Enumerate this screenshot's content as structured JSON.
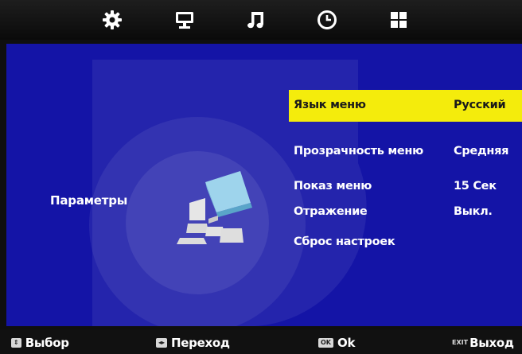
{
  "tabs": [
    {
      "icon": "gear-icon",
      "active": true
    },
    {
      "icon": "monitor-icon",
      "active": false
    },
    {
      "icon": "music-note-icon",
      "active": false
    },
    {
      "icon": "clock-icon",
      "active": false
    },
    {
      "icon": "grid-icon",
      "active": false
    }
  ],
  "section_title": "Параметры",
  "menu": [
    {
      "label": "Язык меню",
      "value": "Русский",
      "selected": true
    },
    {
      "label": "Прозрачность меню",
      "value": "Средняя",
      "selected": false
    },
    {
      "label": "Показ меню",
      "value": "15 Сек",
      "selected": false
    },
    {
      "label": "Отражение",
      "value": "Выкл.",
      "selected": false
    },
    {
      "label": "Сброс настроек",
      "value": "",
      "selected": false
    }
  ],
  "hints": [
    {
      "key": "⇕",
      "label": "Выбор"
    },
    {
      "key": "◂▸",
      "label": "Переход"
    },
    {
      "key": "OK",
      "label": "Ok"
    },
    {
      "key": "EXIT",
      "label": "Выход"
    }
  ],
  "colors": {
    "panel": "#1414a6",
    "highlight": "#f4ec0c",
    "topbar": "#0f0f0f"
  }
}
